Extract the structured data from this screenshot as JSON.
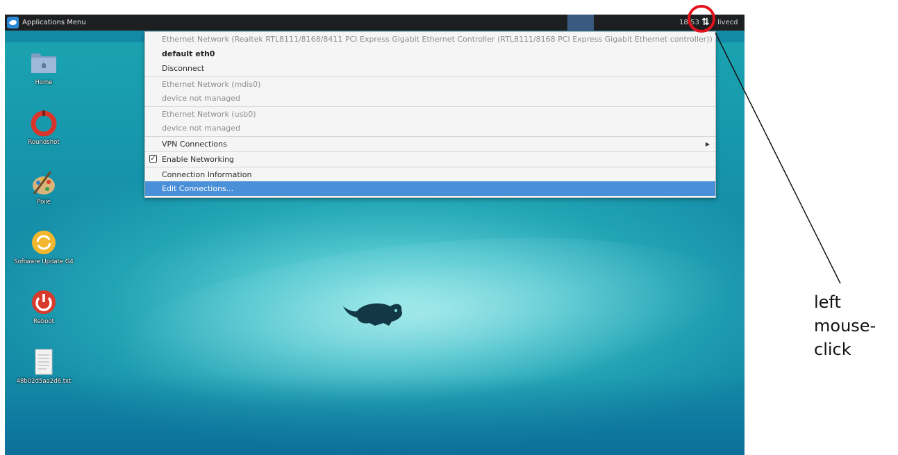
{
  "panel": {
    "app_menu_label": "Applications Menu",
    "clock": "18:53",
    "user": "livecd",
    "net_icon": "network-updown-icon"
  },
  "desktop": {
    "icons": [
      {
        "label": "Home",
        "icon": "folder-home-icon"
      },
      {
        "label": "Roundshot",
        "icon": "roundshot-icon"
      },
      {
        "label": "Pixie",
        "icon": "paint-palette-icon"
      },
      {
        "label": "Software Update G4",
        "icon": "software-update-icon"
      },
      {
        "label": "Reboot",
        "icon": "power-icon"
      },
      {
        "label": "48b02d5aa2d6.txt",
        "icon": "text-file-icon"
      }
    ]
  },
  "network_menu": {
    "items": [
      {
        "label": "Ethernet Network (Realtek RTL8111/8168/8411 PCI Express Gigabit Ethernet Controller (RTL8111/8168 PCI Express Gigabit Ethernet controller))",
        "state": "disabled"
      },
      {
        "label": "default eth0",
        "state": "bold"
      },
      {
        "label": "Disconnect",
        "state": "normal"
      },
      {
        "label": "Ethernet Network (mdis0)",
        "state": "disabled"
      },
      {
        "label": "device not managed",
        "state": "disabled"
      },
      {
        "label": "Ethernet Network (usb0)",
        "state": "disabled"
      },
      {
        "label": "device not managed",
        "state": "disabled"
      },
      {
        "label": "VPN Connections",
        "state": "normal"
      },
      {
        "label": "Enable Networking",
        "state": "checked"
      },
      {
        "label": "Connection Information",
        "state": "normal"
      },
      {
        "label": "Edit Connections...",
        "state": "highlighted"
      }
    ]
  },
  "annotation": {
    "line1": "left",
    "line2": "mouse-",
    "line3": "click",
    "color": "#e3121a"
  }
}
